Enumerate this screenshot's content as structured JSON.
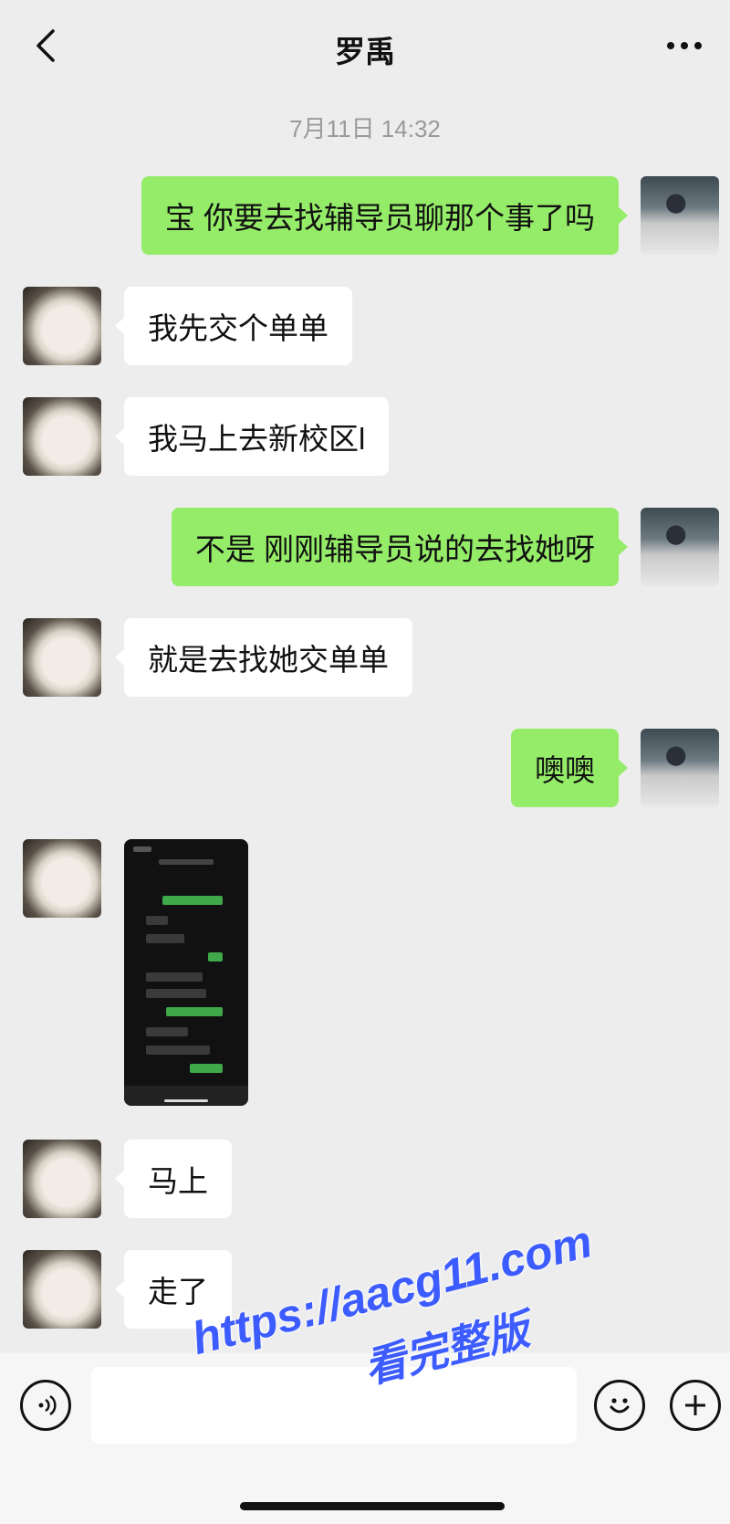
{
  "header": {
    "title": "罗禹"
  },
  "timestamp": "7月11日 14:32",
  "messages": [
    {
      "side": "self",
      "text": "宝 你要去找辅导员聊那个事了吗"
    },
    {
      "side": "other",
      "text": "我先交个单单"
    },
    {
      "side": "other",
      "text": "我马上去新校区l"
    },
    {
      "side": "self",
      "text": "不是  刚刚辅导员说的去找她呀"
    },
    {
      "side": "other",
      "text": "就是去找她交单单"
    },
    {
      "side": "self",
      "text": "噢噢"
    },
    {
      "side": "other",
      "type": "image",
      "alt": "screenshot-thumbnail"
    },
    {
      "side": "other",
      "text": "马上"
    },
    {
      "side": "other",
      "text": "走了"
    }
  ],
  "input_bar": {
    "voice_icon": "voice-icon",
    "emoji_icon": "emoji-icon",
    "plus_icon": "plus-icon"
  },
  "watermark": {
    "line1": "https://aacg11.com",
    "line2": "看完整版"
  },
  "colors": {
    "background": "#ededed",
    "self_bubble": "#95ec69",
    "other_bubble": "#ffffff",
    "watermark": "#3d5cff"
  }
}
